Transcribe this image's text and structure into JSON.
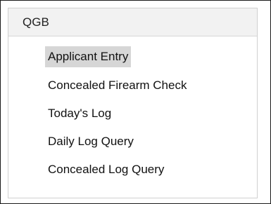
{
  "menu": {
    "header": "QGB",
    "items": [
      {
        "label": "Applicant Entry",
        "selected": true
      },
      {
        "label": "Concealed Firearm Check",
        "selected": false
      },
      {
        "label": "Today's Log",
        "selected": false
      },
      {
        "label": "Daily Log Query",
        "selected": false
      },
      {
        "label": "Concealed Log Query",
        "selected": false
      }
    ]
  }
}
